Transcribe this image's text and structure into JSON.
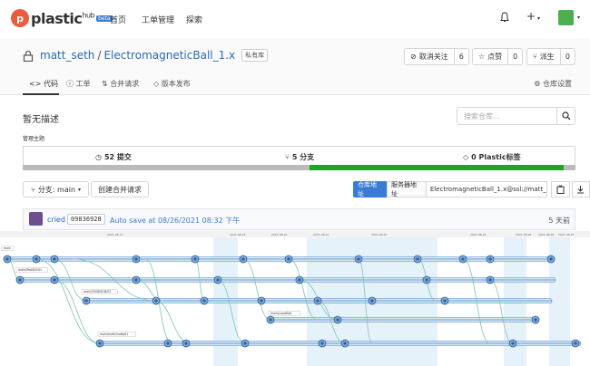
{
  "app": {
    "logo_letter": "p",
    "logo_name": "plastic",
    "logo_hub": "hub",
    "beta": "beta"
  },
  "nav": {
    "home": "首页",
    "work": "工单管理",
    "explore": "探索"
  },
  "topbar": {
    "plus": "+"
  },
  "repo": {
    "owner": "matt_seth",
    "separator": "/",
    "name": "ElectromagneticBall_1.x",
    "private": "私有库"
  },
  "actions": {
    "unwatch": {
      "label": "取消关注",
      "count": "6"
    },
    "star": {
      "label": "点赞",
      "count": "0"
    },
    "fork": {
      "label": "派生",
      "count": "0"
    }
  },
  "tabs": {
    "code": "代码",
    "issues": "工单",
    "pulls": "合并请求",
    "releases": "版本发布",
    "settings": "仓库设置"
  },
  "main": {
    "description": "暂无描述",
    "search_placeholder": "搜索仓库...",
    "topics": "管理主题"
  },
  "stats": {
    "commits": "52 提交",
    "branches": "5 分支",
    "labels": "0 Plastic标签"
  },
  "toolbar": {
    "branch_label": "分支: main",
    "new_pr": "创建合并请求",
    "repo_url_btn": "仓库地址",
    "server_url_btn": "服务器地址",
    "clone_url": "ElectromagneticBall_1.x@ssl://matt_seth@"
  },
  "commit": {
    "user": "cried",
    "hash": "09836928",
    "message": "Auto save at 08/26/2021 08:32 下午",
    "time": "5 天前"
  },
  "graph": {
    "date_labels": [
      "2021-08-17",
      "2021-08-19",
      "2021-08-20",
      "2021-08-21",
      "2021-08-22",
      "2021-08-24",
      "2021-08-25",
      "2021-08-26",
      "2021-08-27"
    ],
    "branch_labels": [
      "main",
      "main/TestSDC01",
      "main/20080818/01",
      "main/LexiaBall",
      "main/matt/mattp01"
    ]
  },
  "colors": {
    "accent": "#3a7bd5",
    "progress": "#21a32a",
    "graph_line": "#4a86c8",
    "graph_merge": "#7cc6b0"
  }
}
